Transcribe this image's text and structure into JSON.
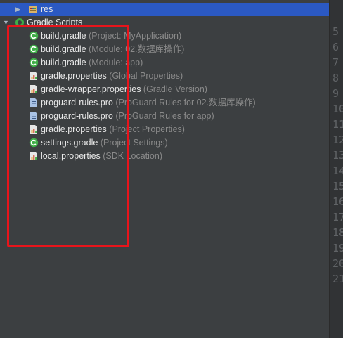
{
  "tree": {
    "res": {
      "label": "res"
    },
    "gradle_scripts": {
      "label": "Gradle Scripts"
    },
    "items": [
      {
        "name": "build.gradle",
        "hint": "(Project: MyApplication)",
        "icon": "gradle-icon"
      },
      {
        "name": "build.gradle",
        "hint": "(Module: 02.数据库操作)",
        "icon": "gradle-icon"
      },
      {
        "name": "build.gradle",
        "hint": "(Module: app)",
        "icon": "gradle-icon"
      },
      {
        "name": "gradle.properties",
        "hint": "(Global Properties)",
        "icon": "properties-icon"
      },
      {
        "name": "gradle-wrapper.properties",
        "hint": "(Gradle Version)",
        "icon": "properties-icon"
      },
      {
        "name": "proguard-rules.pro",
        "hint": "(ProGuard Rules for 02.数据库操作)",
        "icon": "text-file-icon"
      },
      {
        "name": "proguard-rules.pro",
        "hint": "(ProGuard Rules for app)",
        "icon": "text-file-icon"
      },
      {
        "name": "gradle.properties",
        "hint": "(Project Properties)",
        "icon": "properties-icon"
      },
      {
        "name": "settings.gradle",
        "hint": "(Project Settings)",
        "icon": "gradle-icon"
      },
      {
        "name": "local.properties",
        "hint": "(SDK Location)",
        "icon": "properties-icon"
      }
    ]
  },
  "gutter": {
    "lines": [
      "5",
      "6",
      "7",
      "8",
      "9",
      "10",
      "11",
      "12",
      "13",
      "14",
      "15",
      "16",
      "17",
      "18",
      "19",
      "20",
      "21"
    ]
  },
  "colors": {
    "selection": "#2b59c3",
    "highlight_border": "#e8141b",
    "gradle_green": "#3fae47",
    "panel_bg": "#3c3f41"
  }
}
